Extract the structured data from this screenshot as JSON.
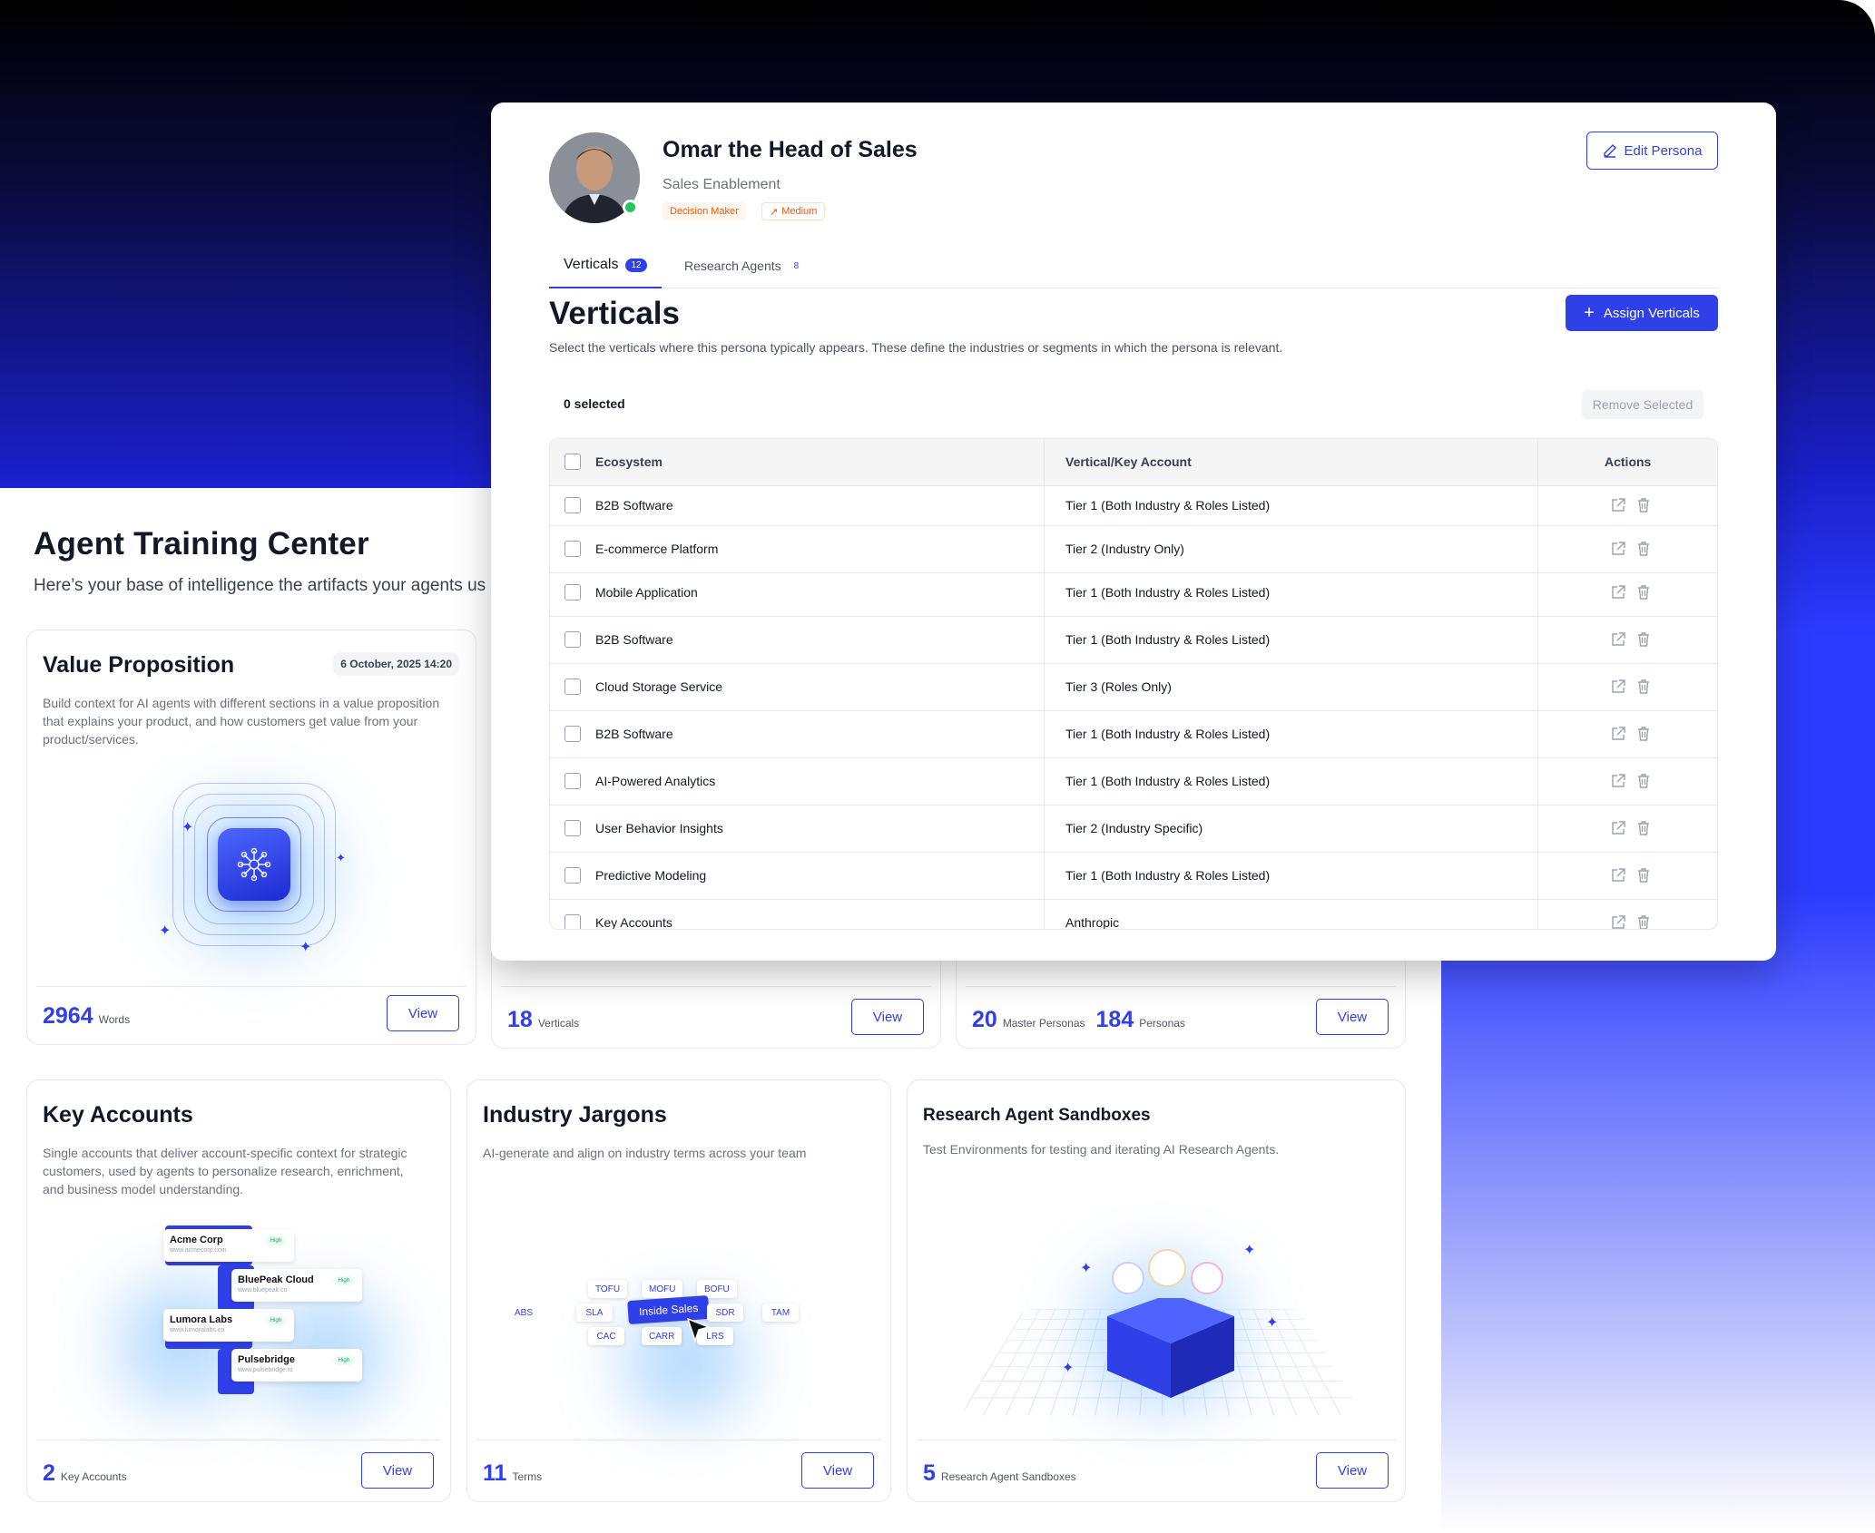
{
  "training_center": {
    "title": "Agent Training Center",
    "subtitle": "Here’s your base of intelligence the artifacts your agents us"
  },
  "cards": {
    "value_proposition": {
      "title": "Value Proposition",
      "date": "6 October, 2025 14:20",
      "description": "Build context for AI agents with different sections in a value proposition that explains your product, and how customers get value from your product/services.",
      "count": "2964",
      "count_label": "Words",
      "view_label": "View"
    },
    "verticals": {
      "count": "18",
      "count_label": "Verticals",
      "view_label": "View"
    },
    "personas": {
      "count_master": "20",
      "count_master_label": "Master Personas",
      "count": "184",
      "count_label": "Personas",
      "view_label": "View"
    },
    "key_accounts": {
      "title": "Key Accounts",
      "description": "Single accounts that deliver account-specific context for strategic customers, used by agents to personalize research, enrichment, and business model understanding.",
      "accounts": [
        {
          "name": "Acme Corp",
          "url": "www.acmecorp.com",
          "badge": "High"
        },
        {
          "name": "BluePeak Cloud",
          "url": "www.bluepeak.co",
          "badge": "High"
        },
        {
          "name": "Lumora Labs",
          "url": "www.lumoralabs.co",
          "badge": "High"
        },
        {
          "name": "Pulsebridge",
          "url": "www.pulsebridge.io",
          "badge": "High"
        }
      ],
      "count": "2",
      "count_label": "Key Accounts",
      "view_label": "View"
    },
    "industry_jargons": {
      "title": "Industry Jargons",
      "description": "AI-generate and align on industry terms across your team",
      "chips": [
        "TOFU",
        "MOFU",
        "BOFU",
        "ABS",
        "SLA",
        "Inside Sales",
        "SDR",
        "TAM",
        "CAC",
        "CARR",
        "LRS"
      ],
      "count": "11",
      "count_label": "Terms",
      "view_label": "View"
    },
    "sandboxes": {
      "title": "Research Agent Sandboxes",
      "description": "Test Environments for testing and iterating AI Research Agents.",
      "count": "5",
      "count_label": "Research Agent Sandboxes",
      "view_label": "View"
    }
  },
  "persona": {
    "name": "Omar the Head of Sales",
    "role": "Sales Enablement",
    "tags": {
      "decision_maker": "Decision Maker",
      "influence": "Medium"
    },
    "edit_label": "Edit Persona",
    "tabs": [
      {
        "label": "Verticals",
        "count": "12"
      },
      {
        "label": "Research Agents",
        "count": "8"
      }
    ],
    "section_title": "Verticals",
    "section_desc": "Select the verticals where this persona typically appears. These define the industries or segments in which the persona is relevant.",
    "assign_label": "Assign Verticals",
    "selected_text": "0 selected",
    "remove_label": "Remove Selected",
    "columns": [
      "Ecosystem",
      "Vertical/Key Account",
      "Actions"
    ],
    "rows": [
      {
        "ecosystem": "B2B Software",
        "vertical": "Tier 1 (Both Industry & Roles Listed)"
      },
      {
        "ecosystem": "E-commerce Platform",
        "vertical": "Tier 2 (Industry Only)"
      },
      {
        "ecosystem": "Mobile Application",
        "vertical": "Tier 1 (Both Industry & Roles Listed)"
      },
      {
        "ecosystem": "B2B Software",
        "vertical": "Tier 1 (Both Industry & Roles Listed)"
      },
      {
        "ecosystem": "Cloud Storage Service",
        "vertical": "Tier 3 (Roles Only)"
      },
      {
        "ecosystem": "B2B Software",
        "vertical": "Tier 1 (Both Industry & Roles Listed)"
      },
      {
        "ecosystem": "AI-Powered Analytics",
        "vertical": "Tier 1 (Both Industry & Roles Listed)"
      },
      {
        "ecosystem": "User Behavior Insights",
        "vertical": "Tier 2 (Industry Specific)"
      },
      {
        "ecosystem": "Predictive Modeling",
        "vertical": "Tier 1 (Both Industry & Roles Listed)"
      },
      {
        "ecosystem": "Key Accounts",
        "vertical": "Anthropic"
      }
    ]
  },
  "colors": {
    "accent": "#2f40e8",
    "online": "#22c55e",
    "tag_orange": "#ea580c"
  },
  "icons": [
    "pencil-icon",
    "plus-icon",
    "external-link-icon",
    "trash-icon",
    "sparkle-icon",
    "brain-icon",
    "cursor-icon",
    "arrow-up-right-icon"
  ]
}
